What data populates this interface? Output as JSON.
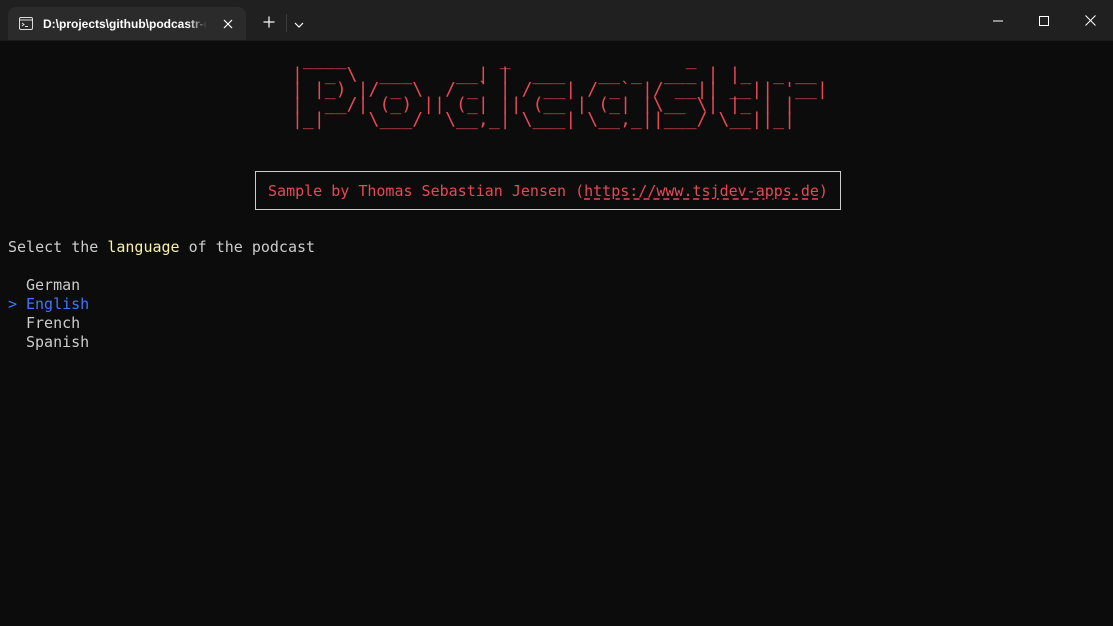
{
  "window": {
    "tab_title": "D:\\projects\\github\\podcastr-cli",
    "new_tab_icon": "plus-icon",
    "dropdown_icon": "chevron-down-icon",
    "controls": [
      "minimize-icon",
      "maximize-icon",
      "close-icon"
    ]
  },
  "terminal": {
    "banner_lines": [
      " ____              _                _        ",
      "|  _ \\  ___    __| |  ___   __ _  ___ | |_  _ __ ",
      "| |_) |/ _ \\  / _` | / __| / _` |/ __|| __|| '__|",
      "|  __/| (_) || (_| || (__ | (_| |\\__ \\| |_ | |   ",
      "|_|    \\___/  \\__,_| \\___| \\__,_||___/ \\__||_|   "
    ],
    "credit_prefix": "Sample by Thomas Sebastian Jensen (",
    "credit_link": "https://www.tsjdev-apps.de",
    "credit_suffix": ")",
    "prompt_before": "Select the ",
    "prompt_highlight": "language",
    "prompt_after": " of the podcast",
    "selection_marker": ">",
    "options": [
      {
        "label": "German",
        "selected": false
      },
      {
        "label": "English",
        "selected": true
      },
      {
        "label": "French",
        "selected": false
      },
      {
        "label": "Spanish",
        "selected": false
      }
    ]
  },
  "colors": {
    "banner": "#e74856",
    "highlight": "#f9f1a5",
    "selected": "#3b78ff",
    "background": "#0c0c0c"
  }
}
